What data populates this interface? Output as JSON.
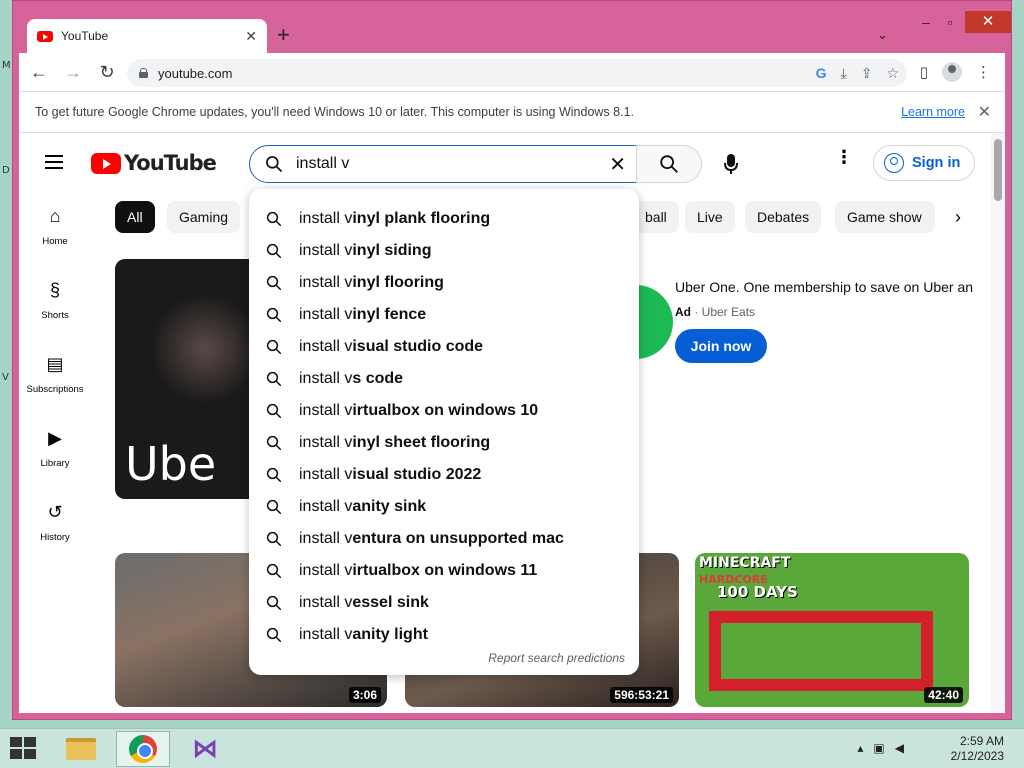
{
  "browser": {
    "tab_title": "YouTube",
    "url": "youtube.com",
    "infobar_message": "To get future Google Chrome updates, you'll need Windows 10 or later. This computer is using Windows 8.1.",
    "infobar_link": "Learn more"
  },
  "youtube": {
    "logo_text": "YouTube",
    "search_query": "install v",
    "sign_in": "Sign in",
    "guide": [
      {
        "label": "Home",
        "icon": "home-icon"
      },
      {
        "label": "Shorts",
        "icon": "shorts-icon"
      },
      {
        "label": "Subscriptions",
        "icon": "subscriptions-icon"
      },
      {
        "label": "Library",
        "icon": "library-icon"
      },
      {
        "label": "History",
        "icon": "history-icon"
      }
    ],
    "chips": [
      "All",
      "Gaming",
      "ball",
      "Live",
      "Debates",
      "Game show"
    ],
    "suggestions": [
      {
        "typed": "install v",
        "rest": "inyl plank flooring"
      },
      {
        "typed": "install v",
        "rest": "inyl siding"
      },
      {
        "typed": "install v",
        "rest": "inyl flooring"
      },
      {
        "typed": "install v",
        "rest": "inyl fence"
      },
      {
        "typed": "install v",
        "rest": "isual studio code"
      },
      {
        "typed": "install v",
        "rest": "s code"
      },
      {
        "typed": "install v",
        "rest": "irtualbox on windows 10"
      },
      {
        "typed": "install v",
        "rest": "inyl sheet flooring"
      },
      {
        "typed": "install v",
        "rest": "isual studio 2022"
      },
      {
        "typed": "install v",
        "rest": "anity sink"
      },
      {
        "typed": "install v",
        "rest": "entura on unsupported mac"
      },
      {
        "typed": "install v",
        "rest": "irtualbox on windows 11"
      },
      {
        "typed": "install v",
        "rest": "essel sink"
      },
      {
        "typed": "install v",
        "rest": "anity light"
      }
    ],
    "report_link": "Report search predictions",
    "ad": {
      "thumb_text": "Ube",
      "title": "Uber One. One membership to save on Uber an",
      "label": "Ad",
      "advertiser": "Uber Eats",
      "cta": "Join now"
    },
    "videos": [
      {
        "duration": "3:06"
      },
      {
        "duration": "596:53:21"
      },
      {
        "duration": "42:40",
        "thumb_title": "MINECRAFT",
        "thumb_sub": "HARDCORE",
        "thumb_days": "100 DAYS"
      }
    ]
  },
  "taskbar": {
    "time": "2:59 AM",
    "date": "2/12/2023"
  },
  "colors": {
    "window_frame": "#d6649b",
    "accent_blue": "#065fd4",
    "youtube_red": "#ff0000"
  }
}
